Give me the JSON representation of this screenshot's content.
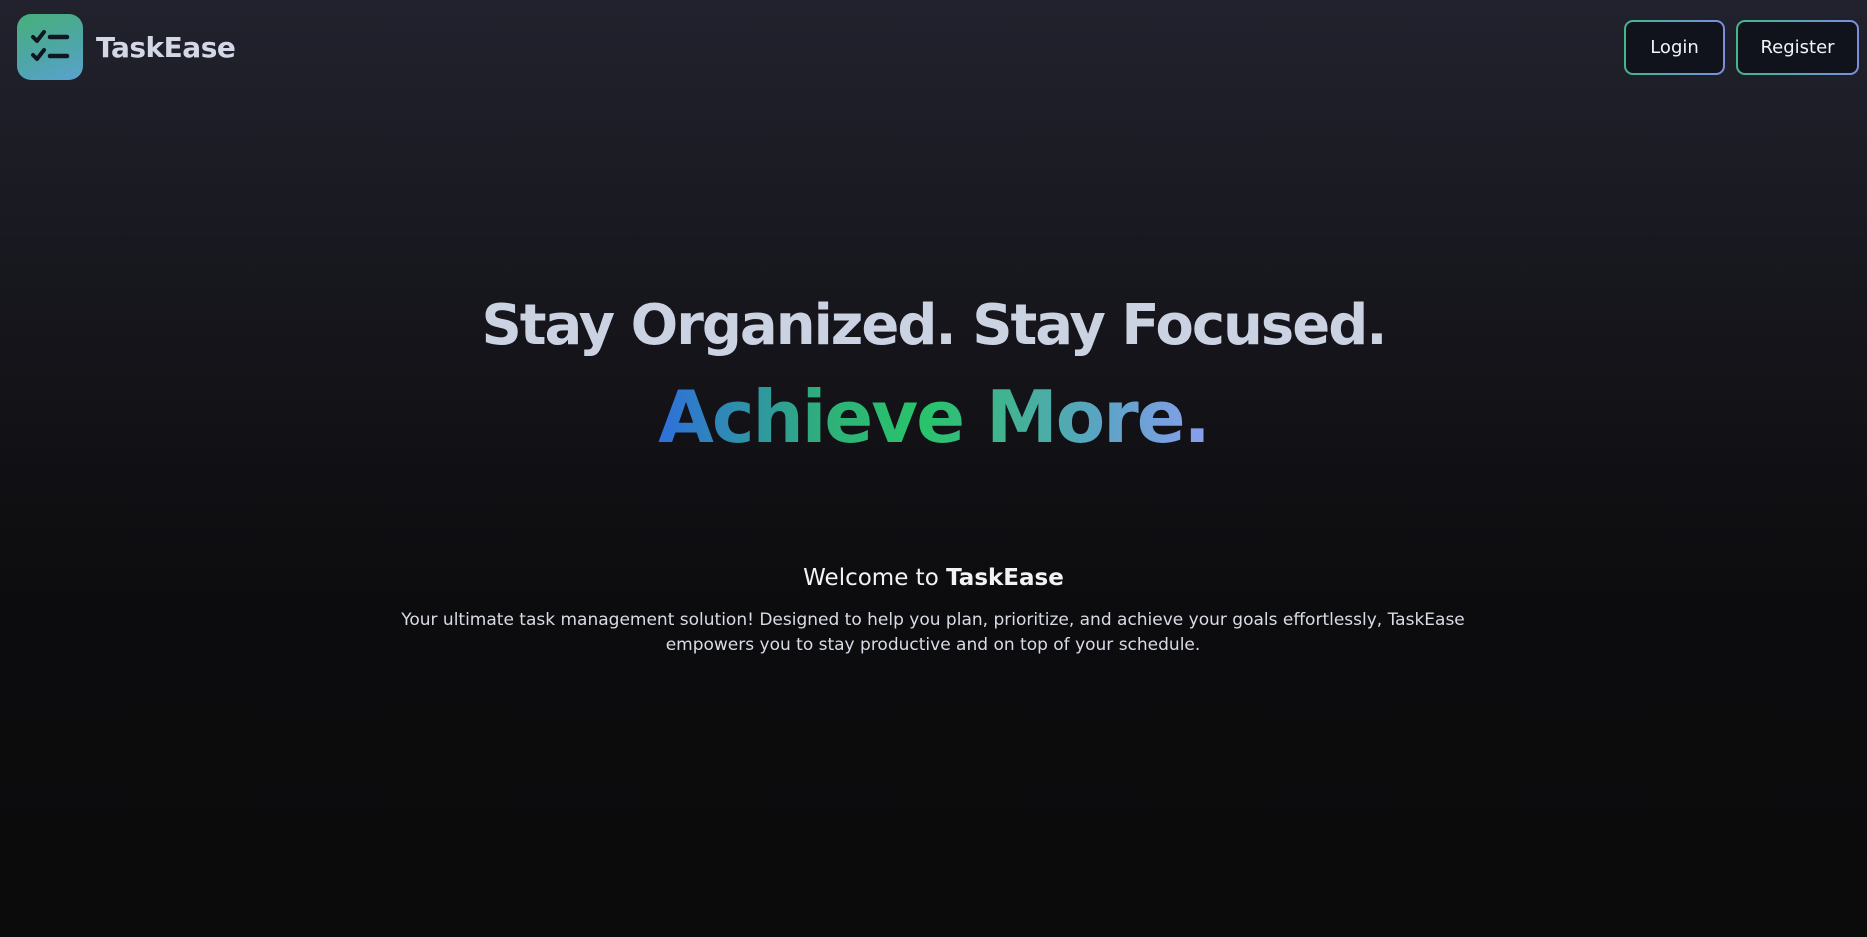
{
  "brand": {
    "name": "TaskEase",
    "logo_icon": "checklist-icon"
  },
  "nav": {
    "login_label": "Login",
    "register_label": "Register"
  },
  "hero": {
    "line1": "Stay Organized. Stay Focused.",
    "line2": "Achieve More."
  },
  "welcome": {
    "prefix": "Welcome to ",
    "name": "TaskEase"
  },
  "description": "Your ultimate task management solution! Designed to help you plan, prioritize, and achieve your goals effortlessly, TaskEase empowers you to stay productive and on top of your schedule.",
  "colors": {
    "background": "#0b0b0c",
    "accent_green": "#28c46a",
    "accent_blue": "#2f6fdc",
    "accent_violet": "#8a9ef0"
  }
}
